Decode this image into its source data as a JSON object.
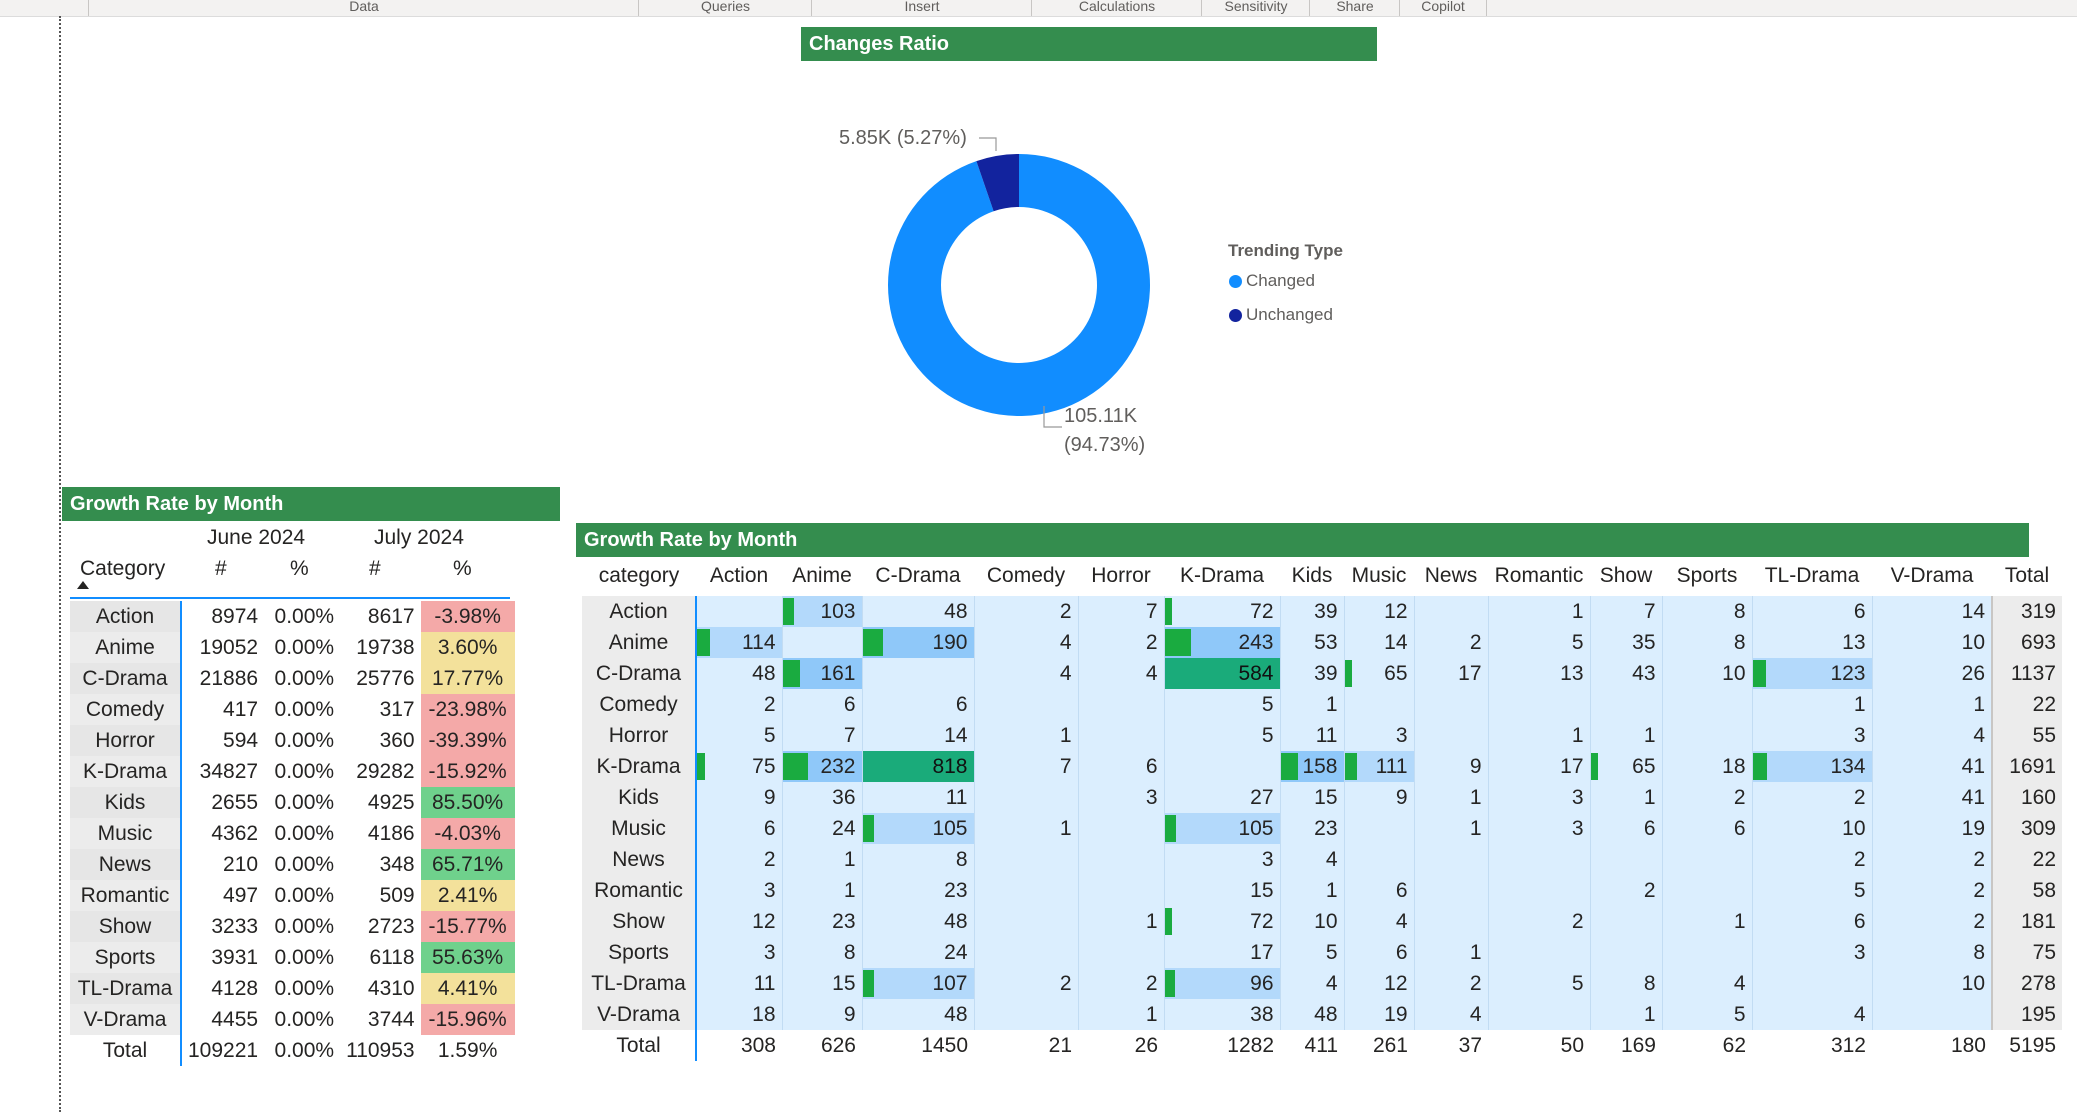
{
  "ribbon": {
    "groups": [
      "Data",
      "Queries",
      "Insert",
      "Calculations",
      "Sensitivity",
      "Share",
      "Copilot"
    ]
  },
  "donut_visual": {
    "title": "Changes Ratio",
    "label_unchanged": "5.85K (5.27%)",
    "label_changed_1": "105.11K",
    "label_changed_2": "(94.73%)",
    "legend_title": "Trending Type",
    "legend": [
      "Changed",
      "Unchanged"
    ],
    "colors": {
      "changed": "#118dff",
      "unchanged": "#12239e"
    },
    "chart_data": {
      "type": "pie",
      "labels": [
        "Changed",
        "Unchanged"
      ],
      "values": [
        105110,
        5850
      ],
      "percent": [
        94.73,
        5.27
      ]
    }
  },
  "small_table": {
    "title": "Growth Rate by Month",
    "col_category": "Category",
    "month1": "June 2024",
    "month2": "July 2024",
    "hash": "#",
    "pct": "%",
    "rows": [
      {
        "cat": "Action",
        "n1": "8974",
        "p1": "0.00%",
        "n2": "8617",
        "p2": "-3.98%",
        "c": "#f4a9a8"
      },
      {
        "cat": "Anime",
        "n1": "19052",
        "p1": "0.00%",
        "n2": "19738",
        "p2": "3.60%",
        "c": "#f3e19b"
      },
      {
        "cat": "C-Drama",
        "n1": "21886",
        "p1": "0.00%",
        "n2": "25776",
        "p2": "17.77%",
        "c": "#f3e19b"
      },
      {
        "cat": "Comedy",
        "n1": "417",
        "p1": "0.00%",
        "n2": "317",
        "p2": "-23.98%",
        "c": "#f4a9a8"
      },
      {
        "cat": "Horror",
        "n1": "594",
        "p1": "0.00%",
        "n2": "360",
        "p2": "-39.39%",
        "c": "#f4a9a8"
      },
      {
        "cat": "K-Drama",
        "n1": "34827",
        "p1": "0.00%",
        "n2": "29282",
        "p2": "-15.92%",
        "c": "#f4a9a8"
      },
      {
        "cat": "Kids",
        "n1": "2655",
        "p1": "0.00%",
        "n2": "4925",
        "p2": "85.50%",
        "c": "#6fd18c"
      },
      {
        "cat": "Music",
        "n1": "4362",
        "p1": "0.00%",
        "n2": "4186",
        "p2": "-4.03%",
        "c": "#f4a9a8"
      },
      {
        "cat": "News",
        "n1": "210",
        "p1": "0.00%",
        "n2": "348",
        "p2": "65.71%",
        "c": "#6fd18c"
      },
      {
        "cat": "Romantic",
        "n1": "497",
        "p1": "0.00%",
        "n2": "509",
        "p2": "2.41%",
        "c": "#f3e19b"
      },
      {
        "cat": "Show",
        "n1": "3233",
        "p1": "0.00%",
        "n2": "2723",
        "p2": "-15.77%",
        "c": "#f4a9a8"
      },
      {
        "cat": "Sports",
        "n1": "3931",
        "p1": "0.00%",
        "n2": "6118",
        "p2": "55.63%",
        "c": "#6fd18c"
      },
      {
        "cat": "TL-Drama",
        "n1": "4128",
        "p1": "0.00%",
        "n2": "4310",
        "p2": "4.41%",
        "c": "#f3e19b"
      },
      {
        "cat": "V-Drama",
        "n1": "4455",
        "p1": "0.00%",
        "n2": "3744",
        "p2": "-15.96%",
        "c": "#f4a9a8"
      }
    ],
    "total": {
      "cat": "Total",
      "n1": "109221",
      "p1": "0.00%",
      "n2": "110953",
      "p2": "1.59%"
    }
  },
  "matrix": {
    "title": "Growth Rate by Month",
    "corner": "category",
    "columns": [
      "Action",
      "Anime",
      "C-Drama",
      "Comedy",
      "Horror",
      "K-Drama",
      "Kids",
      "Music",
      "News",
      "Romantic",
      "Show",
      "Sports",
      "TL-Drama",
      "V-Drama",
      "Total"
    ],
    "rows": [
      {
        "label": "Action",
        "cells": [
          "",
          "103",
          "48",
          "2",
          "7",
          "72",
          "39",
          "12",
          "",
          "1",
          "7",
          "8",
          "6",
          "14",
          "319"
        ]
      },
      {
        "label": "Anime",
        "cells": [
          "114",
          "",
          "190",
          "4",
          "2",
          "243",
          "53",
          "14",
          "2",
          "5",
          "35",
          "8",
          "13",
          "10",
          "693"
        ]
      },
      {
        "label": "C-Drama",
        "cells": [
          "48",
          "161",
          "",
          "4",
          "4",
          "584",
          "39",
          "65",
          "17",
          "13",
          "43",
          "10",
          "123",
          "26",
          "1137"
        ]
      },
      {
        "label": "Comedy",
        "cells": [
          "2",
          "6",
          "6",
          "",
          "",
          "5",
          "1",
          "",
          "",
          "",
          "",
          "",
          "1",
          "1",
          "22"
        ]
      },
      {
        "label": "Horror",
        "cells": [
          "5",
          "7",
          "14",
          "1",
          "",
          "5",
          "11",
          "3",
          "",
          "1",
          "1",
          "",
          "3",
          "4",
          "55"
        ]
      },
      {
        "label": "K-Drama",
        "cells": [
          "75",
          "232",
          "818",
          "7",
          "6",
          "",
          "158",
          "111",
          "9",
          "17",
          "65",
          "18",
          "134",
          "41",
          "1691"
        ]
      },
      {
        "label": "Kids",
        "cells": [
          "9",
          "36",
          "11",
          "",
          "3",
          "27",
          "15",
          "9",
          "1",
          "3",
          "1",
          "2",
          "2",
          "41",
          "160"
        ]
      },
      {
        "label": "Music",
        "cells": [
          "6",
          "24",
          "105",
          "1",
          "",
          "105",
          "23",
          "",
          "1",
          "3",
          "6",
          "6",
          "10",
          "19",
          "309"
        ]
      },
      {
        "label": "News",
        "cells": [
          "2",
          "1",
          "8",
          "",
          "",
          "3",
          "4",
          "",
          "",
          "",
          "",
          "",
          "2",
          "2",
          "22"
        ]
      },
      {
        "label": "Romantic",
        "cells": [
          "3",
          "1",
          "23",
          "",
          "",
          "15",
          "1",
          "6",
          "",
          "",
          "2",
          "",
          "5",
          "2",
          "58"
        ]
      },
      {
        "label": "Show",
        "cells": [
          "12",
          "23",
          "48",
          "",
          "1",
          "72",
          "10",
          "4",
          "",
          "2",
          "",
          "1",
          "6",
          "2",
          "181"
        ]
      },
      {
        "label": "Sports",
        "cells": [
          "3",
          "8",
          "24",
          "",
          "",
          "17",
          "5",
          "6",
          "1",
          "",
          "",
          "",
          "3",
          "8",
          "75"
        ]
      },
      {
        "label": "TL-Drama",
        "cells": [
          "11",
          "15",
          "107",
          "2",
          "2",
          "96",
          "4",
          "12",
          "2",
          "5",
          "8",
          "4",
          "",
          "10",
          "278"
        ]
      },
      {
        "label": "V-Drama",
        "cells": [
          "18",
          "9",
          "48",
          "",
          "1",
          "38",
          "48",
          "19",
          "4",
          "",
          "1",
          "5",
          "4",
          "",
          "195"
        ]
      }
    ],
    "total": {
      "label": "Total",
      "cells": [
        "308",
        "626",
        "1450",
        "21",
        "26",
        "1282",
        "411",
        "261",
        "37",
        "50",
        "169",
        "62",
        "312",
        "180",
        "5195"
      ]
    }
  }
}
